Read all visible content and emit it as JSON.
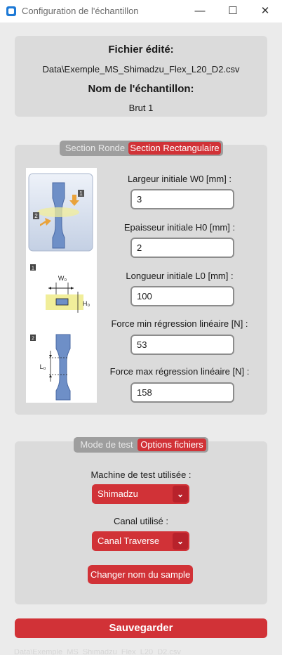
{
  "window": {
    "title": "Configuration de l'échantillon",
    "minimize": "—",
    "maximize": "☐",
    "close": "✕"
  },
  "file_panel": {
    "file_heading": "Fichier édité:",
    "file_path": "Data\\Exemple_MS_Shimadzu_Flex_L20_D2.csv",
    "sample_heading": "Nom de l'échantillon:",
    "sample_name": "Brut 1"
  },
  "section_panel": {
    "tabs": [
      "Section Ronde",
      "Section Rectangulaire"
    ],
    "selected_tab": "Section Rectangulaire",
    "figure_labels": {
      "step1": "1",
      "step2": "2",
      "w0": "W₀",
      "h0": "H₀",
      "l0": "L₀"
    },
    "fields": [
      {
        "label": "Largeur initiale W0 [mm] :",
        "value": "3"
      },
      {
        "label": "Epaisseur initiale H0 [mm] :",
        "value": "2"
      },
      {
        "label": "Longueur initiale L0 [mm] :",
        "value": "100"
      },
      {
        "label": "Force min régression linéaire [N] :",
        "value": "53"
      },
      {
        "label": "Force max régression linéaire [N] :",
        "value": "158"
      }
    ]
  },
  "options_panel": {
    "tabs": [
      "Mode de test",
      "Options fichiers"
    ],
    "selected_tab": "Options fichiers",
    "machine_label": "Machine de test utilisée :",
    "machine_value": "Shimadzu",
    "channel_label": "Canal utilisé :",
    "channel_value": "Canal Traverse",
    "change_button": "Changer nom du sample"
  },
  "save_button": "Sauvegarder",
  "colors": {
    "accent": "#d13237",
    "panel": "#dbdbdb",
    "background": "#ebebeb",
    "segmented": "#9e9e9e",
    "figure_blue": "#6e8fc7",
    "figure_yellow": "#f1ee9a"
  }
}
